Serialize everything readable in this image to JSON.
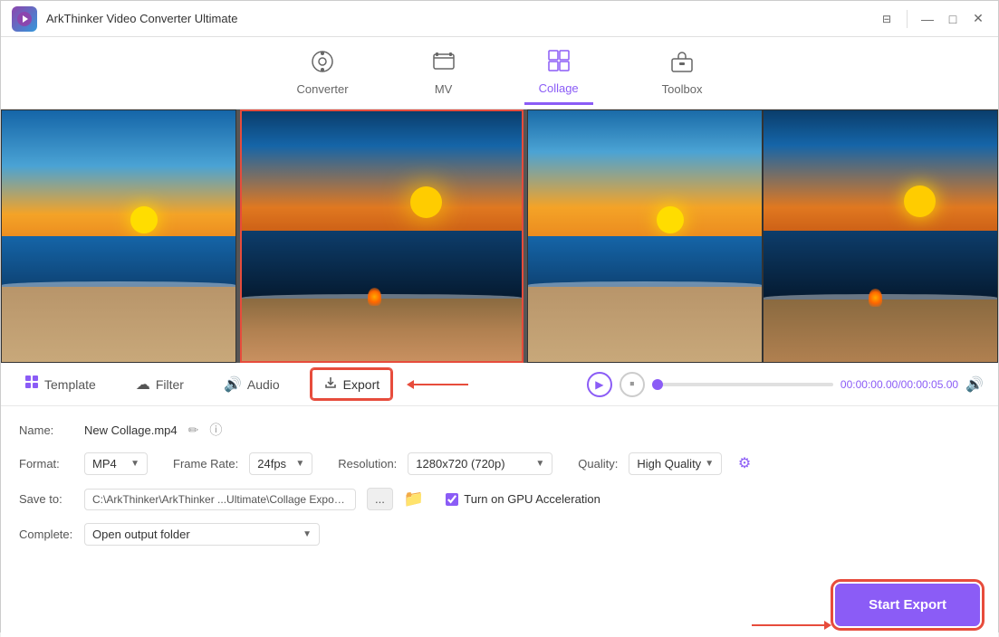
{
  "app": {
    "title": "ArkThinker Video Converter Ultimate",
    "icon": "🎬"
  },
  "titlebar": {
    "controls": {
      "menu_label": "☰",
      "minimize_label": "—",
      "maximize_label": "□",
      "close_label": "✕"
    }
  },
  "navbar": {
    "items": [
      {
        "id": "converter",
        "label": "Converter",
        "icon": "⊙",
        "active": false
      },
      {
        "id": "mv",
        "label": "MV",
        "icon": "📺",
        "active": false
      },
      {
        "id": "collage",
        "label": "Collage",
        "icon": "⊞",
        "active": true
      },
      {
        "id": "toolbox",
        "label": "Toolbox",
        "icon": "🧰",
        "active": false
      }
    ]
  },
  "toolbar": {
    "template_label": "Template",
    "filter_label": "Filter",
    "audio_label": "Audio",
    "export_label": "Export"
  },
  "playback": {
    "time_current": "00:00:00.00",
    "time_total": "00:00:05.00",
    "time_separator": "/"
  },
  "settings": {
    "name_label": "Name:",
    "name_value": "New Collage.mp4",
    "format_label": "Format:",
    "format_value": "MP4",
    "framerate_label": "Frame Rate:",
    "framerate_value": "24fps",
    "resolution_label": "Resolution:",
    "resolution_value": "1280x720 (720p)",
    "quality_label": "Quality:",
    "quality_value": "High Quality",
    "saveto_label": "Save to:",
    "saveto_path": "C:\\ArkThinker\\ArkThinker ...Ultimate\\Collage Exported",
    "gpu_label": "Turn on GPU Acceleration",
    "complete_label": "Complete:",
    "complete_value": "Open output folder"
  },
  "buttons": {
    "start_export": "Start Export",
    "dots": "...",
    "edit_icon": "✏",
    "info_icon": "ⓘ"
  },
  "colors": {
    "accent": "#8b5cf6",
    "danger": "#e74c3c"
  }
}
